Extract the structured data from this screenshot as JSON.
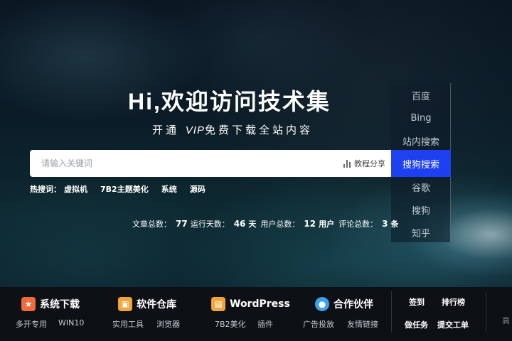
{
  "hero": {
    "headline": "Hi,欢迎访问技术集",
    "subline_pre": "开通",
    "subline_vip": "VIP",
    "subline_post": "免费下载全站内容"
  },
  "search": {
    "placeholder": "请输入关键词",
    "tutorial_label": "教程分享"
  },
  "engines": [
    {
      "label": "百度"
    },
    {
      "label": "Bing"
    },
    {
      "label": "站内搜索"
    },
    {
      "label": "搜狗搜索",
      "active": true
    },
    {
      "label": "谷歌"
    },
    {
      "label": "搜狗"
    },
    {
      "label": "知乎"
    }
  ],
  "hot": {
    "label": "热搜词：",
    "items": [
      "虚拟机",
      "7B2主题美化",
      "系统",
      "源码"
    ]
  },
  "stats": {
    "articles_label": "文章总数：",
    "articles_value": "77",
    "days_label": "运行天数：",
    "days_value": "46",
    "days_unit": "天",
    "users_label": "用户总数：",
    "users_value": "12",
    "users_unit": "用户",
    "comments_label": "评论总数：",
    "comments_value": "3",
    "comments_unit": "条"
  },
  "footer": {
    "categories": [
      {
        "label": "系统下载",
        "icon": "star-badge-icon",
        "color": "#f06a3c",
        "subs": [
          "多开专用",
          "WIN10"
        ]
      },
      {
        "label": "软件仓库",
        "icon": "briefcase-icon",
        "color": "#f2a33a",
        "subs": [
          "实用工具",
          "浏览器"
        ]
      },
      {
        "label": "WordPress",
        "icon": "document-icon",
        "color": "#f0a43a",
        "subs": [
          "7B2美化",
          "插件"
        ]
      },
      {
        "label": "合作伙伴",
        "icon": "location-pin-icon",
        "color": "#3aa0f0",
        "subs": [
          "广告投放",
          "友情链接"
        ]
      }
    ],
    "quick_links": [
      "签到",
      "排行榜",
      "做任务",
      "提交工单"
    ],
    "edge_text": "高"
  },
  "colors": {
    "accent": "#1a3df0",
    "footer_bg": "#0d1115"
  }
}
